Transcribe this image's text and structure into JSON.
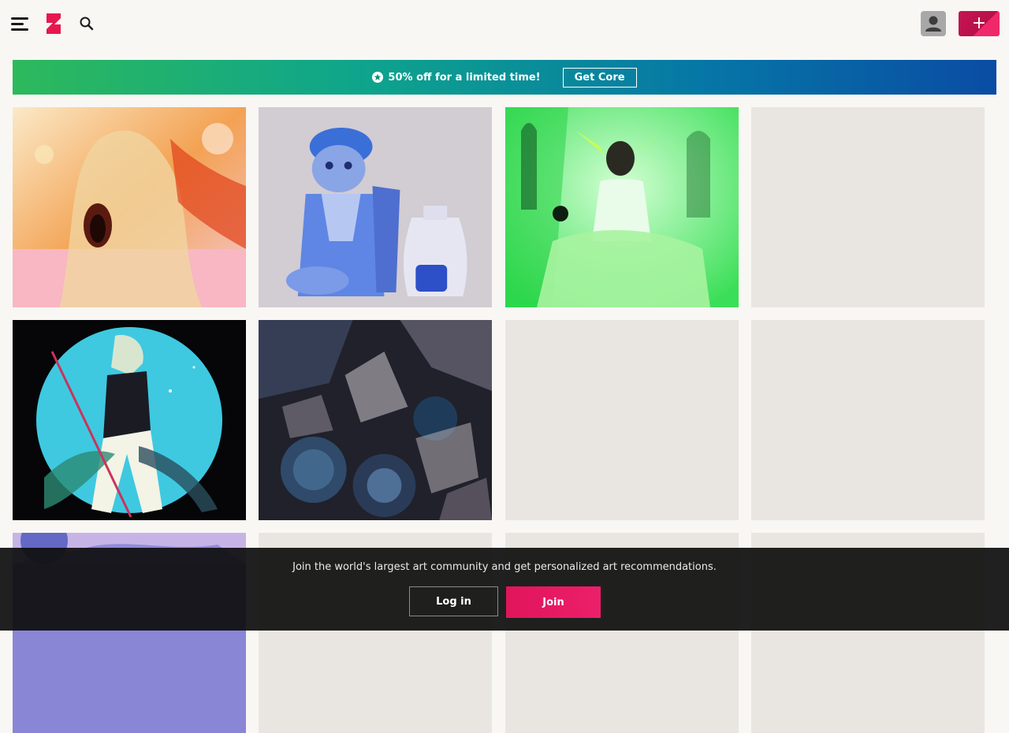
{
  "header": {
    "menu_icon": "hamburger-menu-icon",
    "logo_icon": "deviantart-logo-icon",
    "search_icon": "search-icon",
    "avatar_icon": "user-avatar-icon",
    "create_icon": "plus-icon",
    "create_label": "+"
  },
  "promo": {
    "text": "50% off for a limited time!",
    "button_label": "Get Core",
    "icon": "core-badge-icon"
  },
  "grid": {
    "tiles": [
      {
        "name": "artwork-tree-cave",
        "loaded": true
      },
      {
        "name": "artwork-blue-cat-vase",
        "loaded": true
      },
      {
        "name": "artwork-green-figure",
        "loaded": true
      },
      {
        "name": "artwork-placeholder",
        "loaded": false
      },
      {
        "name": "artwork-moon-warrior",
        "loaded": true
      },
      {
        "name": "artwork-abstract-dark",
        "loaded": true
      },
      {
        "name": "artwork-placeholder",
        "loaded": false
      },
      {
        "name": "artwork-placeholder",
        "loaded": false
      }
    ]
  },
  "cta": {
    "message": "Join the world's largest art community and get personalized art recommendations.",
    "login_label": "Log in",
    "join_label": "Join"
  },
  "colors": {
    "background": "#f8f7f4",
    "brand_pink": "#e0155a",
    "promo_green": "#2db95b",
    "promo_blue": "#0a4ca4"
  }
}
